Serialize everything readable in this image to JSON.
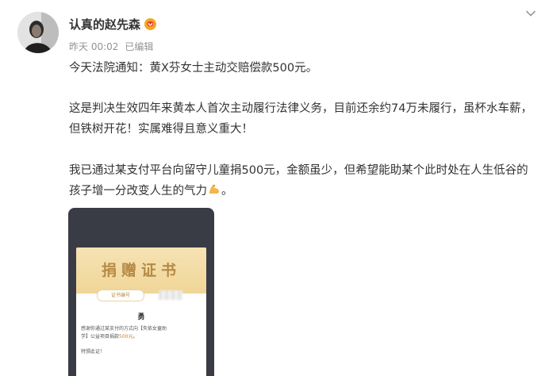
{
  "post": {
    "author": "认真的赵先森",
    "time": "昨天 00:02",
    "edited": "已编辑",
    "p1": "今天法院通知：黄X芬女士主动交赔偿款500元。",
    "p2": "这是判决生效四年来黄本人首次主动履行法律义务，目前还余约74万未履行，虽杯水车薪，但铁树开花！实属难得且意义重大！",
    "p3": "我已通过某支付平台向留守儿童捐500元，金额虽少，但希望能助某个此时处在人生低谷的孩子增一分改变人生的气力",
    "badge_icon": "verified-badge-icon",
    "menu_icon": "chevron-down-icon",
    "emoji_icon": "flexed-biceps-icon"
  },
  "certificate": {
    "title": "捐赠证书",
    "serial_label": "证书编号",
    "recipient": "勇",
    "body_lines": [
      "感谢你通过某支付的方式向【失依女童助",
      "学】公益项目捐款"
    ],
    "amount": "500元",
    "amount_suffix": "。",
    "thanks": "特颁此证！",
    "colors": {
      "gold": "#b58a45",
      "gold_bg": "#f0d597",
      "card_bg": "#3a3c45"
    }
  }
}
